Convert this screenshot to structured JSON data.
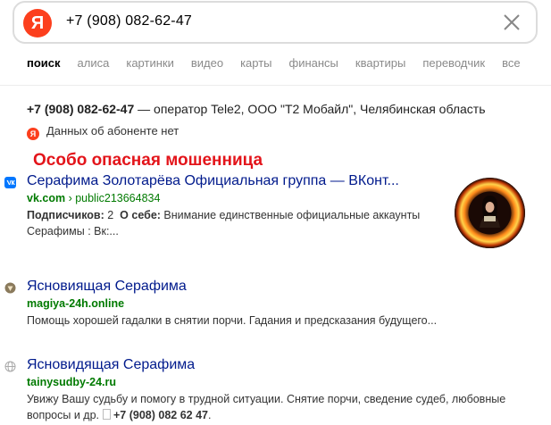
{
  "search": {
    "logo_letter": "Я",
    "query": "+7 (908) 082-62-47"
  },
  "tabs": [
    "поиск",
    "алиса",
    "картинки",
    "видео",
    "карты",
    "финансы",
    "квартиры",
    "переводчик",
    "все"
  ],
  "phone_info": {
    "number": "+7 (908) 082-62-47",
    "operator_text": " — оператор Tele2, ООО \"Т2 Мобайл\", Челябинская область",
    "no_data_text": "Данных об абоненте нет",
    "no_data_icon_letter": "Я"
  },
  "annotation": "Особо опасная мошенница",
  "results": [
    {
      "title": "Серафима Золотарёва Официальная группа — ВКонт...",
      "domain": "vk.com",
      "path": " › public213664834",
      "desc_label1": "Подписчиков:",
      "desc_value1": " 2",
      "desc_label2": "О себе:",
      "desc_value2": " Внимание единственные официальные аккаунты Серафимы : Вк:...",
      "favicon": "vk-icon"
    },
    {
      "title": "Ясновиящая Серафима",
      "domain": "magiya-24h.online",
      "desc": "Помощь хорошей гадалки в снятии порчи. Гадания и предсказания будущего...",
      "favicon": "shield-icon"
    },
    {
      "title": "Ясновидящая Серафима",
      "domain": "tainysudby-24.ru",
      "desc_text": "Увижу Вашу судьбу и помогу в трудной ситуации. Снятие порчи, сведение судеб, любовные вопросы и др.",
      "desc_phone": "+7 (908) 082 62 47",
      "desc_end": ".",
      "favicon": "globe-icon"
    }
  ],
  "colors": {
    "brand": "#fc3f1d",
    "link": "#001a8c",
    "url": "#007a00",
    "annotation": "#e3141a"
  }
}
